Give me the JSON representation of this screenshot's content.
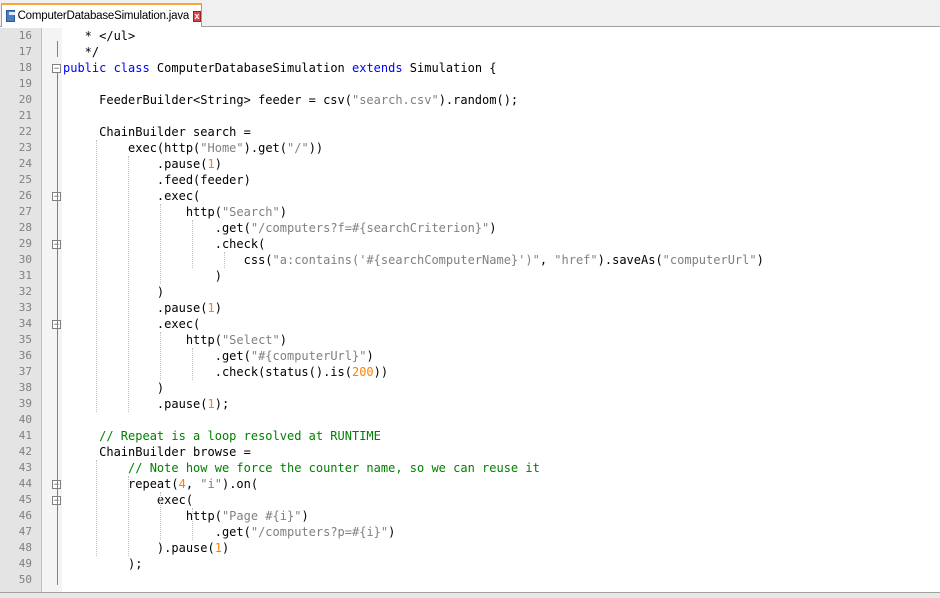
{
  "tab": {
    "filename": "ComputerDatabaseSimulation.java",
    "close_symbol": "x"
  },
  "colors": {
    "keyword": "#0000ff",
    "string": "#808080",
    "number": "#ff8000",
    "comment": "#008000",
    "accent_tab": "#f9a53b"
  },
  "icons": {
    "save": "save-icon",
    "close": "close-icon",
    "fold_minus": "fold-collapse-icon"
  },
  "lines": [
    {
      "n": "16",
      "fold": "",
      "segs": [
        [
          "",
          "   * </ul>"
        ]
      ]
    },
    {
      "n": "17",
      "fold": "",
      "segs": [
        [
          "",
          "   */"
        ]
      ]
    },
    {
      "n": "18",
      "fold": "minus",
      "segs": [
        [
          "kw",
          "public class "
        ],
        [
          "",
          "ComputerDatabaseSimulation "
        ],
        [
          "kw",
          "extends "
        ],
        [
          "",
          "Simulation {"
        ]
      ]
    },
    {
      "n": "19",
      "fold": "",
      "segs": [
        [
          "",
          ""
        ]
      ]
    },
    {
      "n": "20",
      "fold": "",
      "segs": [
        [
          "",
          "     FeederBuilder<String> feeder = csv("
        ],
        [
          "str",
          "\"search.csv\""
        ],
        [
          "",
          ").random();"
        ]
      ]
    },
    {
      "n": "21",
      "fold": "",
      "segs": [
        [
          "",
          ""
        ]
      ]
    },
    {
      "n": "22",
      "fold": "",
      "segs": [
        [
          "",
          "     ChainBuilder search ="
        ]
      ]
    },
    {
      "n": "23",
      "fold": "",
      "segs": [
        [
          "",
          "         exec(http("
        ],
        [
          "str",
          "\"Home\""
        ],
        [
          "",
          ").get("
        ],
        [
          "str",
          "\"/\""
        ],
        [
          "",
          "))"
        ]
      ]
    },
    {
      "n": "24",
      "fold": "",
      "segs": [
        [
          "",
          "             .pause("
        ],
        [
          "num",
          "1"
        ],
        [
          "",
          ")"
        ]
      ]
    },
    {
      "n": "25",
      "fold": "",
      "segs": [
        [
          "",
          "             .feed(feeder)"
        ]
      ]
    },
    {
      "n": "26",
      "fold": "minus",
      "segs": [
        [
          "",
          "             .exec("
        ]
      ]
    },
    {
      "n": "27",
      "fold": "",
      "segs": [
        [
          "",
          "                 http("
        ],
        [
          "str",
          "\"Search\""
        ],
        [
          "",
          ")"
        ]
      ]
    },
    {
      "n": "28",
      "fold": "",
      "segs": [
        [
          "",
          "                     .get("
        ],
        [
          "str",
          "\"/computers?f=#{searchCriterion}\""
        ],
        [
          "",
          ")"
        ]
      ]
    },
    {
      "n": "29",
      "fold": "minus",
      "segs": [
        [
          "",
          "                     .check("
        ]
      ]
    },
    {
      "n": "30",
      "fold": "",
      "segs": [
        [
          "",
          "                         css("
        ],
        [
          "str",
          "\"a:contains('#{searchComputerName}')\""
        ],
        [
          "",
          ", "
        ],
        [
          "str",
          "\"href\""
        ],
        [
          "",
          ").saveAs("
        ],
        [
          "str",
          "\"computerUrl\""
        ],
        [
          "",
          ")"
        ]
      ]
    },
    {
      "n": "31",
      "fold": "",
      "segs": [
        [
          "",
          "                     )"
        ]
      ]
    },
    {
      "n": "32",
      "fold": "",
      "segs": [
        [
          "",
          "             )"
        ]
      ]
    },
    {
      "n": "33",
      "fold": "",
      "segs": [
        [
          "",
          "             .pause("
        ],
        [
          "num",
          "1"
        ],
        [
          "",
          ")"
        ]
      ]
    },
    {
      "n": "34",
      "fold": "minus",
      "segs": [
        [
          "",
          "             .exec("
        ]
      ]
    },
    {
      "n": "35",
      "fold": "",
      "segs": [
        [
          "",
          "                 http("
        ],
        [
          "str",
          "\"Select\""
        ],
        [
          "",
          ")"
        ]
      ]
    },
    {
      "n": "36",
      "fold": "",
      "segs": [
        [
          "",
          "                     .get("
        ],
        [
          "str",
          "\"#{computerUrl}\""
        ],
        [
          "",
          ")"
        ]
      ]
    },
    {
      "n": "37",
      "fold": "",
      "segs": [
        [
          "",
          "                     .check(status().is("
        ],
        [
          "num",
          "200"
        ],
        [
          "",
          "))"
        ]
      ]
    },
    {
      "n": "38",
      "fold": "",
      "segs": [
        [
          "",
          "             )"
        ]
      ]
    },
    {
      "n": "39",
      "fold": "",
      "segs": [
        [
          "",
          "             .pause("
        ],
        [
          "num",
          "1"
        ],
        [
          "",
          ");"
        ]
      ]
    },
    {
      "n": "40",
      "fold": "",
      "segs": [
        [
          "",
          ""
        ]
      ]
    },
    {
      "n": "41",
      "fold": "",
      "segs": [
        [
          "com",
          "     // Repeat is a loop resolved at RUNTIME"
        ]
      ]
    },
    {
      "n": "42",
      "fold": "",
      "segs": [
        [
          "",
          "     ChainBuilder browse ="
        ]
      ]
    },
    {
      "n": "43",
      "fold": "",
      "segs": [
        [
          "com",
          "         // Note how we force the counter name, so we can reuse it"
        ]
      ]
    },
    {
      "n": "44",
      "fold": "minus",
      "segs": [
        [
          "",
          "         repeat("
        ],
        [
          "num",
          "4"
        ],
        [
          "",
          ", "
        ],
        [
          "str",
          "\"i\""
        ],
        [
          "",
          ").on("
        ]
      ]
    },
    {
      "n": "45",
      "fold": "minus",
      "segs": [
        [
          "",
          "             exec("
        ]
      ]
    },
    {
      "n": "46",
      "fold": "",
      "segs": [
        [
          "",
          "                 http("
        ],
        [
          "str",
          "\"Page #{i}\""
        ],
        [
          "",
          ")"
        ]
      ]
    },
    {
      "n": "47",
      "fold": "",
      "segs": [
        [
          "",
          "                     .get("
        ],
        [
          "str",
          "\"/computers?p=#{i}\""
        ],
        [
          "",
          ")"
        ]
      ]
    },
    {
      "n": "48",
      "fold": "",
      "segs": [
        [
          "",
          "             ).pause("
        ],
        [
          "num",
          "1"
        ],
        [
          "",
          ")"
        ]
      ]
    },
    {
      "n": "49",
      "fold": "",
      "segs": [
        [
          "",
          "         );"
        ]
      ]
    },
    {
      "n": "50",
      "fold": "",
      "segs": [
        [
          "",
          ""
        ]
      ]
    }
  ]
}
